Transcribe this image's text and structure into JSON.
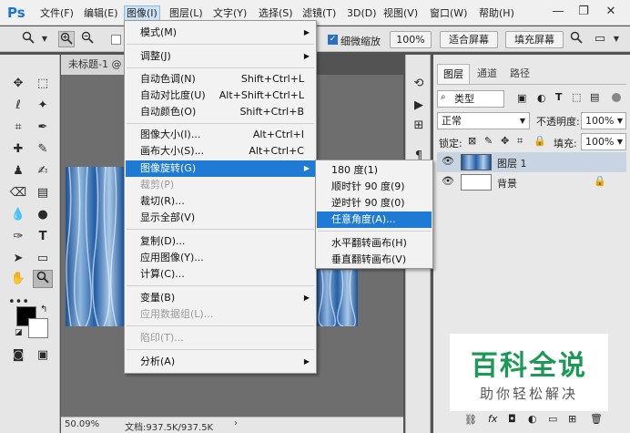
{
  "app": {
    "logo": "Ps"
  },
  "menubar": {
    "items": [
      "文件(F)",
      "编辑(E)",
      "图像(I)",
      "图层(L)",
      "文字(Y)",
      "选择(S)",
      "滤镜(T)",
      "3D(D)",
      "视图(V)",
      "窗口(W)",
      "帮助(H)"
    ],
    "active": "图像(I)"
  },
  "options_bar": {
    "fine_zoom_label": "细微缩放",
    "zoom_100_label": "100%",
    "fit_screen_label": "适合屏幕",
    "fill_screen_label": "填充屏幕",
    "fine_zoom_checked": true
  },
  "document": {
    "tab_title": "未标题-1 @",
    "zoom": "50.09%",
    "doc_info": "文档:937.5K/937.5K"
  },
  "image_menu": {
    "items": [
      {
        "label": "模式(M)",
        "shortcut": "",
        "submenu": true,
        "disabled": false
      },
      {
        "label": "调整(J)",
        "shortcut": "",
        "submenu": true,
        "disabled": false
      },
      {
        "label": "自动色调(N)",
        "shortcut": "Shift+Ctrl+L",
        "submenu": false,
        "disabled": false
      },
      {
        "label": "自动对比度(U)",
        "shortcut": "Alt+Shift+Ctrl+L",
        "submenu": false,
        "disabled": false
      },
      {
        "label": "自动颜色(O)",
        "shortcut": "Shift+Ctrl+B",
        "submenu": false,
        "disabled": false
      },
      {
        "label": "图像大小(I)...",
        "shortcut": "Alt+Ctrl+I",
        "submenu": false,
        "disabled": false
      },
      {
        "label": "画布大小(S)...",
        "shortcut": "Alt+Ctrl+C",
        "submenu": false,
        "disabled": false
      },
      {
        "label": "图像旋转(G)",
        "shortcut": "",
        "submenu": true,
        "disabled": false,
        "highlighted": true
      },
      {
        "label": "裁剪(P)",
        "shortcut": "",
        "submenu": false,
        "disabled": true
      },
      {
        "label": "裁切(R)...",
        "shortcut": "",
        "submenu": false,
        "disabled": false
      },
      {
        "label": "显示全部(V)",
        "shortcut": "",
        "submenu": false,
        "disabled": false
      },
      {
        "label": "复制(D)...",
        "shortcut": "",
        "submenu": false,
        "disabled": false
      },
      {
        "label": "应用图像(Y)...",
        "shortcut": "",
        "submenu": false,
        "disabled": false
      },
      {
        "label": "计算(C)...",
        "shortcut": "",
        "submenu": false,
        "disabled": false
      },
      {
        "label": "变量(B)",
        "shortcut": "",
        "submenu": true,
        "disabled": false
      },
      {
        "label": "应用数据组(L)...",
        "shortcut": "",
        "submenu": false,
        "disabled": true
      },
      {
        "label": "陷印(T)...",
        "shortcut": "",
        "submenu": false,
        "disabled": true
      },
      {
        "label": "分析(A)",
        "shortcut": "",
        "submenu": true,
        "disabled": false
      }
    ]
  },
  "rotate_menu": {
    "items": [
      {
        "label": "180 度(1)",
        "highlighted": false
      },
      {
        "label": "顺时针 90 度(9)",
        "highlighted": false
      },
      {
        "label": "逆时针 90 度(0)",
        "highlighted": false
      },
      {
        "label": "任意角度(A)...",
        "highlighted": true
      },
      {
        "label": "水平翻转画布(H)",
        "highlighted": false
      },
      {
        "label": "垂直翻转画布(V)",
        "highlighted": false
      }
    ]
  },
  "layers_panel": {
    "tabs": [
      "图层",
      "通道",
      "路径"
    ],
    "active_tab": "图层",
    "kind_filter": "类型",
    "blend_mode": "正常",
    "opacity_label": "不透明度:",
    "opacity_value": "100%",
    "lock_label": "锁定:",
    "fill_label": "填充:",
    "fill_value": "100%",
    "layers": [
      {
        "name": "图层 1",
        "selected": true,
        "locked": false
      },
      {
        "name": "背景",
        "selected": false,
        "locked": true
      }
    ]
  },
  "watermark": {
    "title": "百科全说",
    "subtitle": "助你轻松解决"
  },
  "colors": {
    "accent": "#1f7ad3",
    "menu_bg": "#f2f2f2",
    "workspace": "#535353"
  }
}
